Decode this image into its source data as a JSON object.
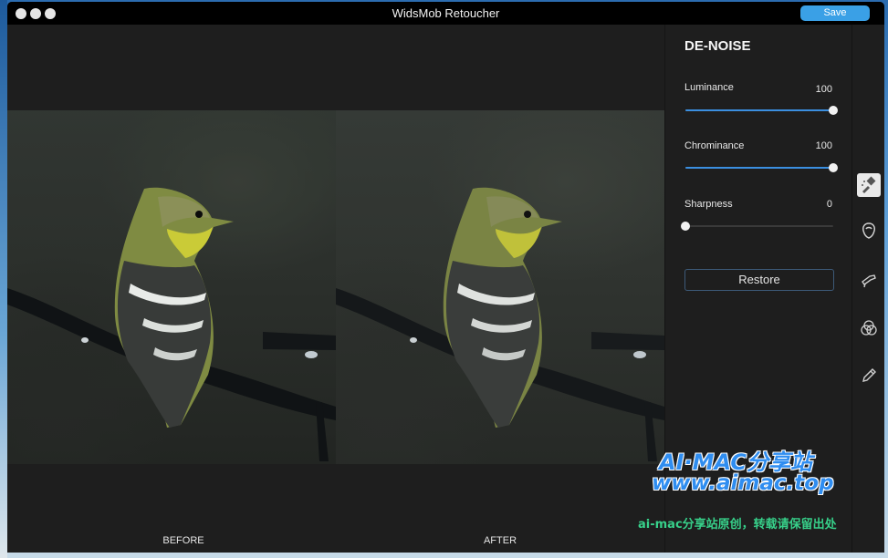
{
  "window": {
    "title": "WidsMob Retoucher",
    "save_label": "Save"
  },
  "canvas": {
    "before_label": "BEFORE",
    "after_label": "AFTER"
  },
  "panel": {
    "title": "DE-NOISE",
    "sliders": [
      {
        "label": "Luminance",
        "value": "100",
        "fraction": 1.0
      },
      {
        "label": "Chrominance",
        "value": "100",
        "fraction": 1.0
      },
      {
        "label": "Sharpness",
        "value": "0",
        "fraction": 0.0
      }
    ],
    "restore_label": "Restore"
  },
  "toolbar": {
    "tools": [
      "denoise-brush-icon",
      "portrait-icon",
      "hair-dryer-icon",
      "color-circles-icon",
      "pencil-icon"
    ]
  },
  "watermark": {
    "line1": "AI·MAC分享站",
    "line2": "www.aimac.top",
    "line3": "ai-mac分享站原创，转载请保留出处"
  },
  "colors": {
    "accent": "#3b8fe0",
    "save_button": "#3aa0e6",
    "window_bg": "#1e1e1e",
    "titlebar_bg": "#000000"
  }
}
